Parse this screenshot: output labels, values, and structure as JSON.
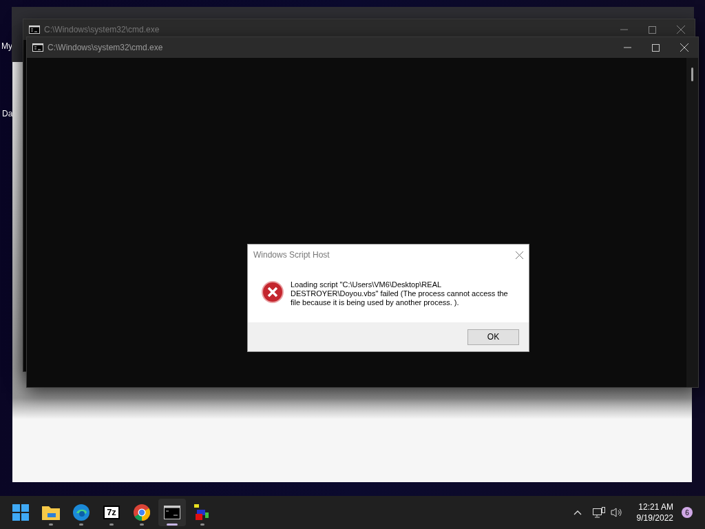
{
  "desktop_icons": [
    {
      "label": "My"
    },
    {
      "label": "Da"
    }
  ],
  "windows": [
    {
      "title": "C:\\Windows\\system32\\cmd.exe",
      "active": false
    },
    {
      "title": "C:\\Windows\\system32\\cmd.exe",
      "active": true
    }
  ],
  "dialog": {
    "title": "Windows Script Host",
    "message": "Loading script \"C:\\Users\\VM6\\Desktop\\REAL DESTROYER\\Doyou.vbs\" failed (The process cannot access the file because it is being used by another process. ).",
    "buttons": [
      "OK"
    ]
  },
  "taskbar": {
    "apps": [
      {
        "kind": "start",
        "running": false,
        "selected": false
      },
      {
        "kind": "folder",
        "running": true,
        "selected": false
      },
      {
        "kind": "edge",
        "running": true,
        "selected": false
      },
      {
        "kind": "archiver",
        "label": "7z",
        "running": true,
        "selected": false
      },
      {
        "kind": "chrome",
        "running": true,
        "selected": false
      },
      {
        "kind": "terminal",
        "running": true,
        "selected": true
      },
      {
        "kind": "cubes",
        "running": true,
        "selected": false
      }
    ],
    "time": "12:21 AM",
    "date": "9/19/2022",
    "notifications": "6"
  }
}
